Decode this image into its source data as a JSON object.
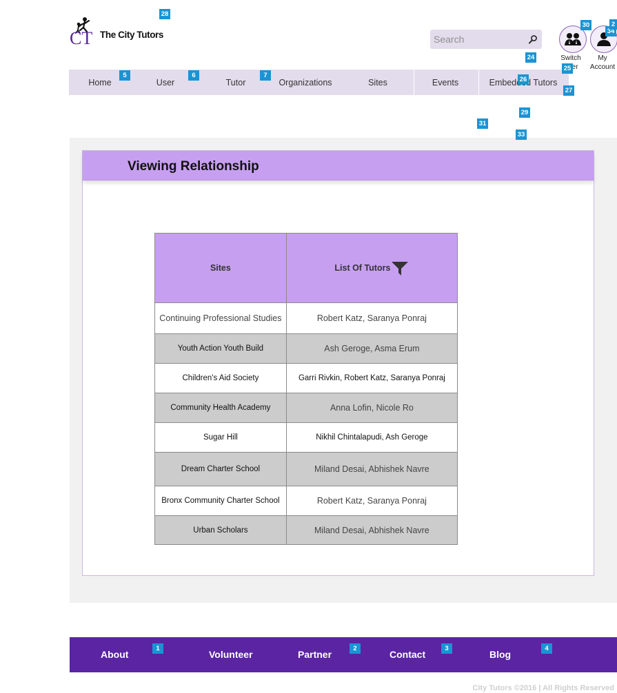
{
  "header": {
    "brand": "The City Tutors",
    "logo_letters": "CT",
    "search": {
      "placeholder": "Search"
    },
    "switch_user": {
      "line1": "Switch",
      "line2": "User"
    },
    "my_account": {
      "line1": "My",
      "line2": "Account"
    }
  },
  "nav": {
    "items": [
      {
        "label": "Home"
      },
      {
        "label": "User"
      },
      {
        "label": "Tutor"
      },
      {
        "label": "Organizations"
      },
      {
        "label": "Sites"
      },
      {
        "label": "Events"
      },
      {
        "label": "Embedded Tutors"
      }
    ]
  },
  "main": {
    "title": "Viewing Relationship",
    "table": {
      "headers": {
        "sites": "Sites",
        "tutors": "List Of Tutors"
      },
      "rows": [
        {
          "site": "Continuing Professional Studies",
          "tutors": "Robert Katz, Saranya Ponraj"
        },
        {
          "site": "Youth Action Youth Build",
          "tutors": "Ash Geroge, Asma Erum"
        },
        {
          "site": "Children's Aid Society",
          "tutors": "Garri Rivkin, Robert Katz, Saranya Ponraj"
        },
        {
          "site": "Community Health Academy",
          "tutors": "Anna Lofin, Nicole Ro"
        },
        {
          "site": "Sugar Hill",
          "tutors": "Nikhil Chintalapudi, Ash Geroge"
        },
        {
          "site": "Dream Charter School",
          "tutors": "Miland Desai, Abhishek Navre"
        },
        {
          "site": "Bronx Community Charter School",
          "tutors": "Robert Katz, Saranya Ponraj"
        },
        {
          "site": "Urban Scholars",
          "tutors": "Miland Desai, Abhishek Navre"
        }
      ]
    }
  },
  "footer": {
    "items": [
      {
        "label": "About"
      },
      {
        "label": "Volunteer"
      },
      {
        "label": "Partner"
      },
      {
        "label": "Contact"
      },
      {
        "label": "Blog"
      }
    ],
    "copyright": "City Tutors ©2016 | All Rights Reserved"
  },
  "markers": [
    "1",
    "2",
    "3",
    "4",
    "5",
    "6",
    "7",
    "24",
    "25",
    "26",
    "27",
    "28",
    "29",
    "30",
    "31",
    "33",
    "34",
    "2"
  ],
  "colors": {
    "accent": "#c79ff0",
    "footer": "#5a24a2",
    "nav": "#e3dcec",
    "marker": "#1a94d4"
  }
}
